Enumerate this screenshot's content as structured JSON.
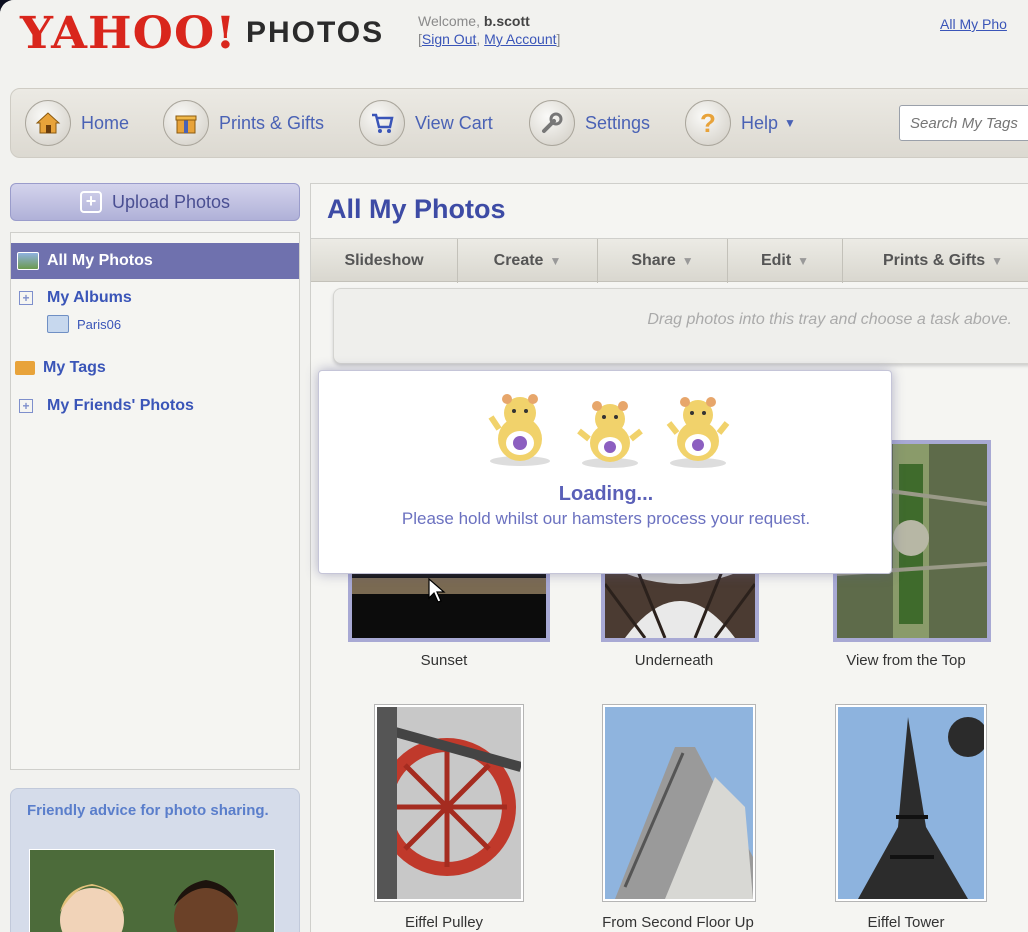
{
  "header": {
    "logo": "YAHOO!",
    "product": "PHOTOS",
    "welcome_prefix": "Welcome,",
    "username": "b.scott",
    "sign_out": "Sign Out",
    "my_account": "My Account",
    "top_link": "All My Pho"
  },
  "toolbar": {
    "home": "Home",
    "prints_gifts": "Prints & Gifts",
    "view_cart": "View Cart",
    "settings": "Settings",
    "help": "Help",
    "search_placeholder": "Search My Tags"
  },
  "sidebar": {
    "upload": "Upload Photos",
    "all_photos": "All My Photos",
    "my_albums": "My Albums",
    "album_paris": "Paris06",
    "my_tags": "My Tags",
    "friends_photos": "My Friends' Photos",
    "advice": "Friendly advice for photo sharing."
  },
  "main": {
    "title": "All My Photos",
    "actions": [
      "Slideshow",
      "Create",
      "Share",
      "Edit",
      "Prints & Gifts"
    ],
    "tray_hint": "Drag photos into this tray and choose a task above.",
    "photos": [
      "Sunset",
      "Underneath",
      "View from the Top",
      "Eiffel Pulley",
      "From Second Floor Up",
      "Eiffel Tower"
    ]
  },
  "overlay": {
    "title": "Loading...",
    "message": "Please hold whilst our hamsters process your request."
  },
  "colors": {
    "brand_red": "#d9261c",
    "link_blue": "#3a55b8",
    "selected_purple": "#6f71ae"
  }
}
